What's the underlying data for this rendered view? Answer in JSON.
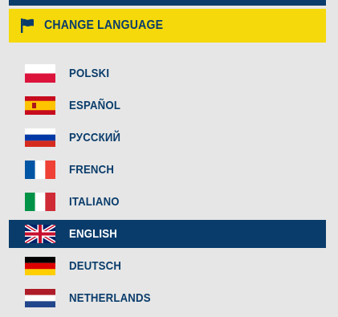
{
  "header": {
    "title": "CHANGE LANGUAGE",
    "icon": "flag-icon",
    "background": "#f5d90a",
    "text_color": "#0a3c6b"
  },
  "languages": [
    {
      "label": "POLSKI",
      "flag": "flag-pl-icon",
      "active": false
    },
    {
      "label": "ESPAÑOL",
      "flag": "flag-es-icon",
      "active": false
    },
    {
      "label": "РУССКИЙ",
      "flag": "flag-ru-icon",
      "active": false
    },
    {
      "label": "FRENCH",
      "flag": "flag-fr-icon",
      "active": false
    },
    {
      "label": "ITALIANO",
      "flag": "flag-it-icon",
      "active": false
    },
    {
      "label": "ENGLISH",
      "flag": "flag-gb-icon",
      "active": true
    },
    {
      "label": "DEUTSCH",
      "flag": "flag-de-icon",
      "active": false
    },
    {
      "label": "NETHERLANDS",
      "flag": "flag-nl-icon",
      "active": false
    }
  ],
  "colors": {
    "navy": "#0a3c6b",
    "yellow": "#f5d90a",
    "panel_background": "#e6e6e6",
    "active_text": "#ffffff"
  }
}
